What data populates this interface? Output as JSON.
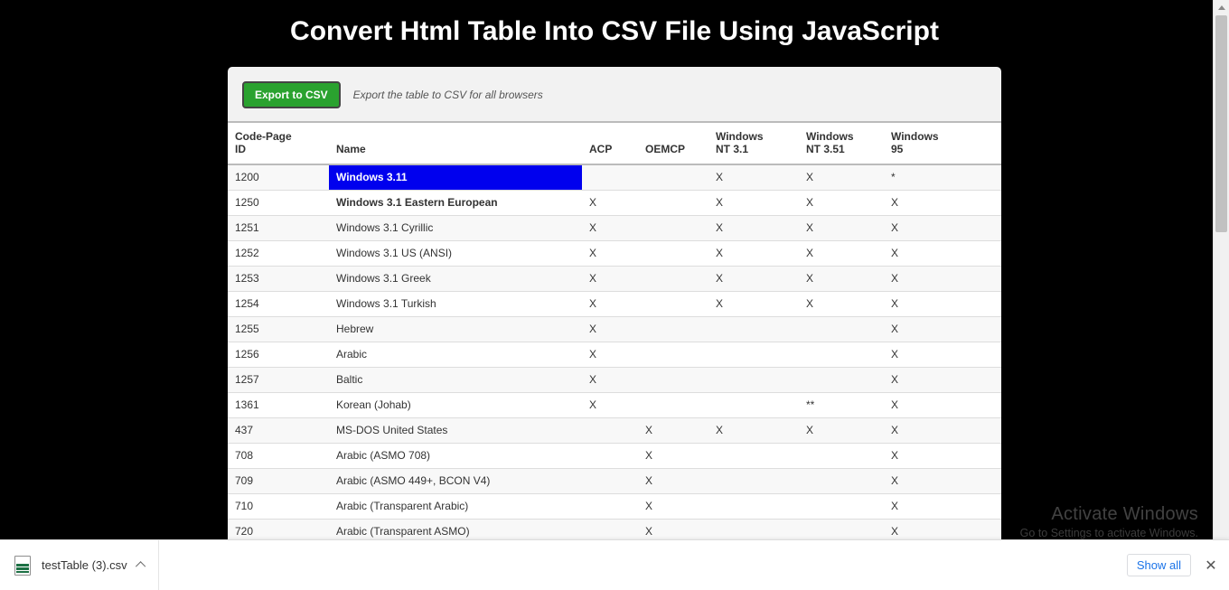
{
  "page_title": "Convert Html Table Into CSV File Using JavaScript",
  "export_button": "Export to CSV",
  "export_note": "Export the table to CSV for all browsers",
  "headers": [
    "Code-Page ID",
    "Name",
    "ACP",
    "OEMCP",
    "Windows NT 3.1",
    "Windows NT 3.51",
    "Windows 95"
  ],
  "rows": [
    [
      "1200",
      "Windows 3.11",
      "",
      "",
      "X",
      "X",
      "*"
    ],
    [
      "1250",
      "Windows 3.1 Eastern European",
      "X",
      "",
      "X",
      "X",
      "X"
    ],
    [
      "1251",
      "Windows 3.1 Cyrillic",
      "X",
      "",
      "X",
      "X",
      "X"
    ],
    [
      "1252",
      "Windows 3.1 US (ANSI)",
      "X",
      "",
      "X",
      "X",
      "X"
    ],
    [
      "1253",
      "Windows 3.1 Greek",
      "X",
      "",
      "X",
      "X",
      "X"
    ],
    [
      "1254",
      "Windows 3.1 Turkish",
      "X",
      "",
      "X",
      "X",
      "X"
    ],
    [
      "1255",
      "Hebrew",
      "X",
      "",
      "",
      "",
      "X"
    ],
    [
      "1256",
      "Arabic",
      "X",
      "",
      "",
      "",
      "X"
    ],
    [
      "1257",
      "Baltic",
      "X",
      "",
      "",
      "",
      "X"
    ],
    [
      "1361",
      "Korean (Johab)",
      "X",
      "",
      "",
      "**",
      "X"
    ],
    [
      "437",
      "MS-DOS United States",
      "",
      "X",
      "X",
      "X",
      "X"
    ],
    [
      "708",
      "Arabic (ASMO 708)",
      "",
      "X",
      "",
      "",
      "X"
    ],
    [
      "709",
      "Arabic (ASMO 449+, BCON V4)",
      "",
      "X",
      "",
      "",
      "X"
    ],
    [
      "710",
      "Arabic (Transparent Arabic)",
      "",
      "X",
      "",
      "",
      "X"
    ],
    [
      "720",
      "Arabic (Transparent ASMO)",
      "",
      "X",
      "",
      "",
      "X"
    ]
  ],
  "download": {
    "file_name": "testTable (3).csv",
    "show_all": "Show all"
  },
  "watermark": {
    "line1": "Activate Windows",
    "line2": "Go to Settings to activate Windows."
  }
}
